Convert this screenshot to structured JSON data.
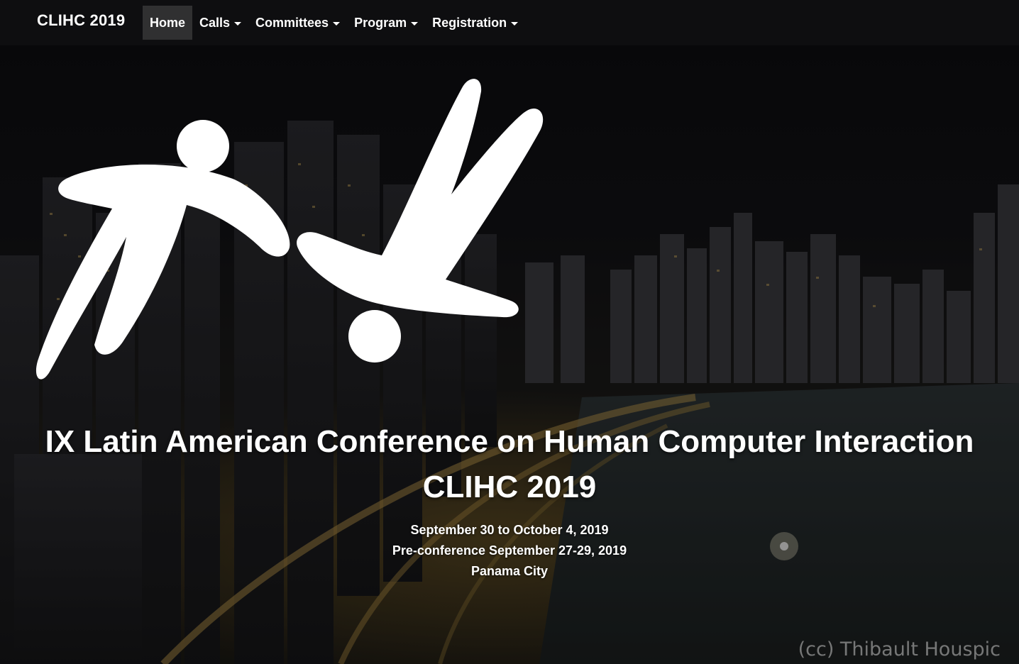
{
  "navbar": {
    "brand": "CLIHC 2019",
    "items": [
      {
        "label": "Home",
        "active": true,
        "dropdown": false
      },
      {
        "label": "Calls",
        "active": false,
        "dropdown": true
      },
      {
        "label": "Committees",
        "active": false,
        "dropdown": true
      },
      {
        "label": "Program",
        "active": false,
        "dropdown": true
      },
      {
        "label": "Registration",
        "active": false,
        "dropdown": true
      }
    ]
  },
  "hero": {
    "title_line1": "IX Latin American Conference on Human Computer Interaction",
    "title_line2": "CLIHC 2019",
    "dates": "September 30 to October 4, 2019",
    "preconference": "Pre-conference September 27-29, 2019",
    "location": "Panama City",
    "photo_credit": "(cc) Thibault Houspic"
  },
  "icons": {
    "logo": "clihc-figures-logo-icon",
    "dropdown": "caret-down-icon"
  },
  "colors": {
    "text": "#ffffff",
    "nav_active_bg": "rgba(255,255,255,0.14)"
  }
}
